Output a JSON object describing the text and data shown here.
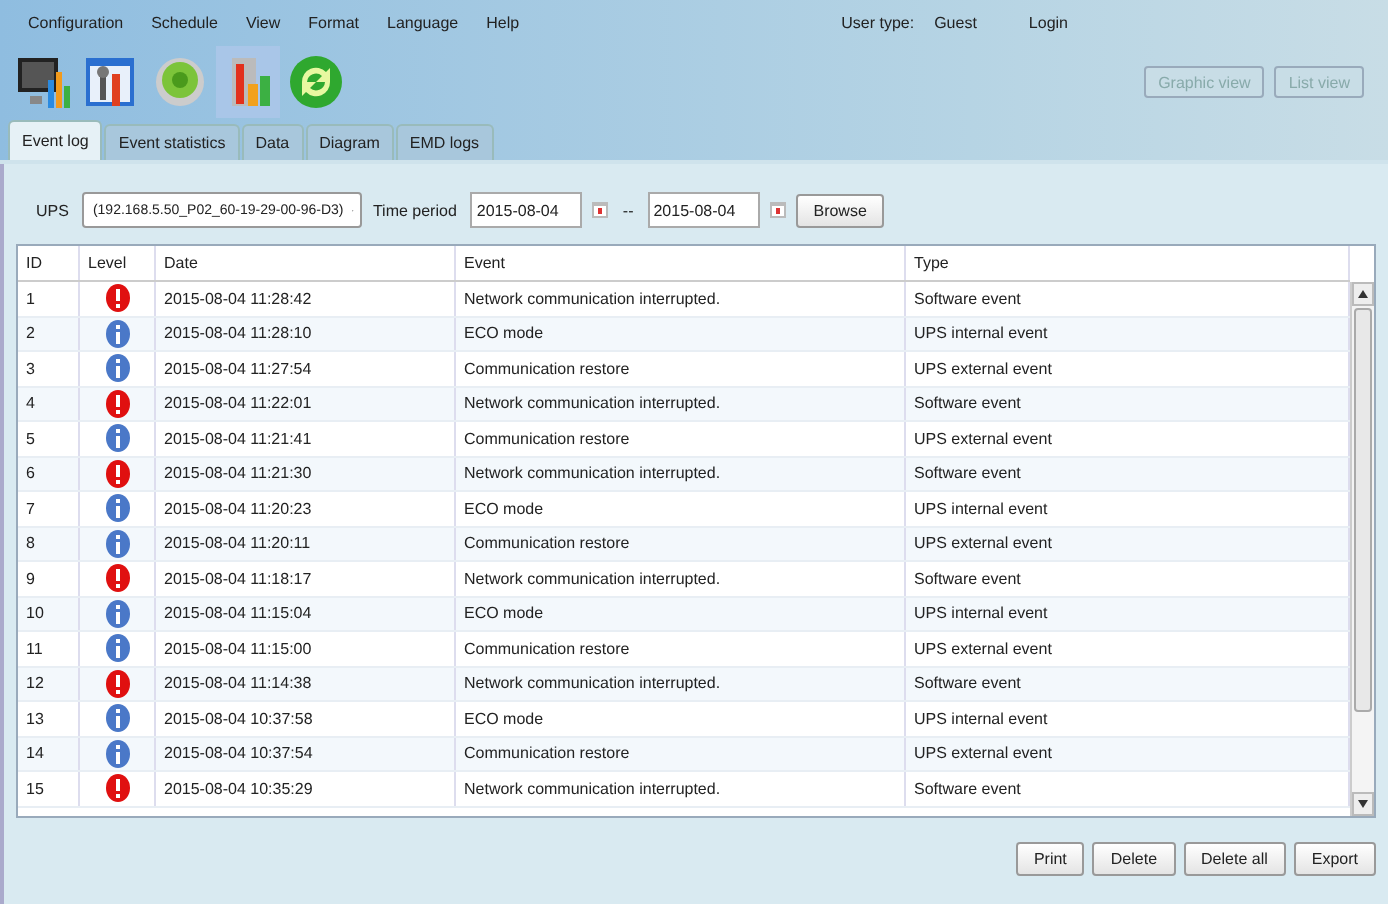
{
  "menu": [
    "Configuration",
    "Schedule",
    "View",
    "Format",
    "Language",
    "Help"
  ],
  "user": {
    "label": "User type:",
    "value": "Guest",
    "login": "Login"
  },
  "toolbar": [
    {
      "kind": "monitor",
      "selected": false
    },
    {
      "kind": "tools",
      "selected": false
    },
    {
      "kind": "disc",
      "selected": false
    },
    {
      "kind": "chart",
      "selected": true
    },
    {
      "kind": "refresh",
      "selected": false
    }
  ],
  "view_buttons": [
    {
      "label": "Graphic view",
      "disabled": true
    },
    {
      "label": "List view",
      "disabled": true
    }
  ],
  "tabs": [
    {
      "label": "Event log",
      "selected": true
    },
    {
      "label": "Event statistics",
      "selected": false
    },
    {
      "label": "Data",
      "selected": false
    },
    {
      "label": "Diagram",
      "selected": false
    },
    {
      "label": "EMD logs",
      "selected": false
    }
  ],
  "filter": {
    "ups_label": "UPS",
    "ups_value": "(192.168.5.50_P02_60-19-29-00-96-D3)",
    "period_label": "Time period",
    "from": "2015-08-04",
    "separator": "--",
    "to": "2015-08-04",
    "browse": "Browse"
  },
  "table": {
    "columns": [
      "ID",
      "Level",
      "Date",
      "Event",
      "Type"
    ],
    "rows": [
      {
        "id": "1",
        "kind": "error",
        "date": "2015-08-04 11:28:42",
        "event": "Network communication interrupted.",
        "type": "Software event"
      },
      {
        "id": "2",
        "kind": "info",
        "date": "2015-08-04 11:28:10",
        "event": "ECO mode",
        "type": "UPS internal event"
      },
      {
        "id": "3",
        "kind": "info",
        "date": "2015-08-04 11:27:54",
        "event": "Communication restore",
        "type": "UPS external event"
      },
      {
        "id": "4",
        "kind": "error",
        "date": "2015-08-04 11:22:01",
        "event": "Network communication interrupted.",
        "type": "Software event"
      },
      {
        "id": "5",
        "kind": "info",
        "date": "2015-08-04 11:21:41",
        "event": "Communication restore",
        "type": "UPS external event"
      },
      {
        "id": "6",
        "kind": "error",
        "date": "2015-08-04 11:21:30",
        "event": "Network communication interrupted.",
        "type": "Software event"
      },
      {
        "id": "7",
        "kind": "info",
        "date": "2015-08-04 11:20:23",
        "event": "ECO mode",
        "type": "UPS internal event"
      },
      {
        "id": "8",
        "kind": "info",
        "date": "2015-08-04 11:20:11",
        "event": "Communication restore",
        "type": "UPS external event"
      },
      {
        "id": "9",
        "kind": "error",
        "date": "2015-08-04 11:18:17",
        "event": "Network communication interrupted.",
        "type": "Software event"
      },
      {
        "id": "10",
        "kind": "info",
        "date": "2015-08-04 11:15:04",
        "event": "ECO mode",
        "type": "UPS internal event"
      },
      {
        "id": "11",
        "kind": "info",
        "date": "2015-08-04 11:15:00",
        "event": "Communication restore",
        "type": "UPS external event"
      },
      {
        "id": "12",
        "kind": "error",
        "date": "2015-08-04 11:14:38",
        "event": "Network communication interrupted.",
        "type": "Software event"
      },
      {
        "id": "13",
        "kind": "info",
        "date": "2015-08-04 10:37:58",
        "event": "ECO mode",
        "type": "UPS internal event"
      },
      {
        "id": "14",
        "kind": "info",
        "date": "2015-08-04 10:37:54",
        "event": "Communication restore",
        "type": "UPS external event"
      },
      {
        "id": "15",
        "kind": "error",
        "date": "2015-08-04 10:35:29",
        "event": "Network communication interrupted.",
        "type": "Software event"
      }
    ]
  },
  "actions": [
    "Print",
    "Delete",
    "Delete all",
    "Export"
  ]
}
